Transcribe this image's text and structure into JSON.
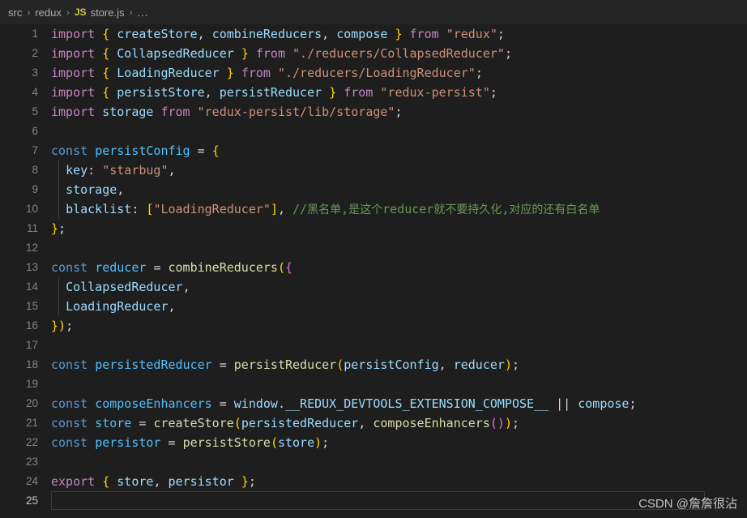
{
  "breadcrumb": {
    "items": [
      {
        "label": "src",
        "icon": null
      },
      {
        "label": "redux",
        "icon": null
      },
      {
        "label": "store.js",
        "icon": "js-file-icon",
        "badge": "JS"
      },
      {
        "label": "...",
        "icon": null
      }
    ],
    "separator": "›",
    "file_badge": "JS",
    "crumb_src": "src",
    "crumb_redux": "redux",
    "crumb_file": "store.js",
    "crumb_dots": "..."
  },
  "editor": {
    "language": "javascript",
    "active_line": 25,
    "total_lines": 25,
    "colors": {
      "background": "#1e1e1e",
      "gutter_text": "#858585",
      "keyword": "#c586c0",
      "const_keyword": "#569cd6",
      "identifier": "#9cdcfe",
      "declared_name": "#4fc1ff",
      "function": "#dcdcaa",
      "string": "#ce9178",
      "comment": "#6a9955",
      "bracket_level1": "#ffd700",
      "bracket_level2": "#da70d6",
      "bracket_level3": "#179fff"
    },
    "lines": [
      {
        "n": "1",
        "text": "import { createStore, combineReducers, compose } from \"redux\";"
      },
      {
        "n": "2",
        "text": "import { CollapsedReducer } from \"./reducers/CollapsedReducer\";"
      },
      {
        "n": "3",
        "text": "import { LoadingReducer } from \"./reducers/LoadingReducer\";"
      },
      {
        "n": "4",
        "text": "import { persistStore, persistReducer } from \"redux-persist\";"
      },
      {
        "n": "5",
        "text": "import storage from \"redux-persist/lib/storage\";"
      },
      {
        "n": "6",
        "text": ""
      },
      {
        "n": "7",
        "text": "const persistConfig = {"
      },
      {
        "n": "8",
        "text": "  key: \"starbug\","
      },
      {
        "n": "9",
        "text": "  storage,"
      },
      {
        "n": "10",
        "text": "  blacklist: [\"LoadingReducer\"], //黑名单,是这个reducer就不要持久化,对应的还有白名单"
      },
      {
        "n": "11",
        "text": "};"
      },
      {
        "n": "12",
        "text": ""
      },
      {
        "n": "13",
        "text": "const reducer = combineReducers({"
      },
      {
        "n": "14",
        "text": "  CollapsedReducer,"
      },
      {
        "n": "15",
        "text": "  LoadingReducer,"
      },
      {
        "n": "16",
        "text": "});"
      },
      {
        "n": "17",
        "text": ""
      },
      {
        "n": "18",
        "text": "const persistedReducer = persistReducer(persistConfig, reducer);"
      },
      {
        "n": "19",
        "text": ""
      },
      {
        "n": "20",
        "text": "const composeEnhancers = window.__REDUX_DEVTOOLS_EXTENSION_COMPOSE__ || compose;"
      },
      {
        "n": "21",
        "text": "const store = createStore(persistedReducer, composeEnhancers());"
      },
      {
        "n": "22",
        "text": "const persistor = persistStore(store);"
      },
      {
        "n": "23",
        "text": ""
      },
      {
        "n": "24",
        "text": "export { store, persistor };"
      },
      {
        "n": "25",
        "text": ""
      }
    ]
  },
  "watermark": {
    "text": "CSDN @詹詹很沾"
  }
}
